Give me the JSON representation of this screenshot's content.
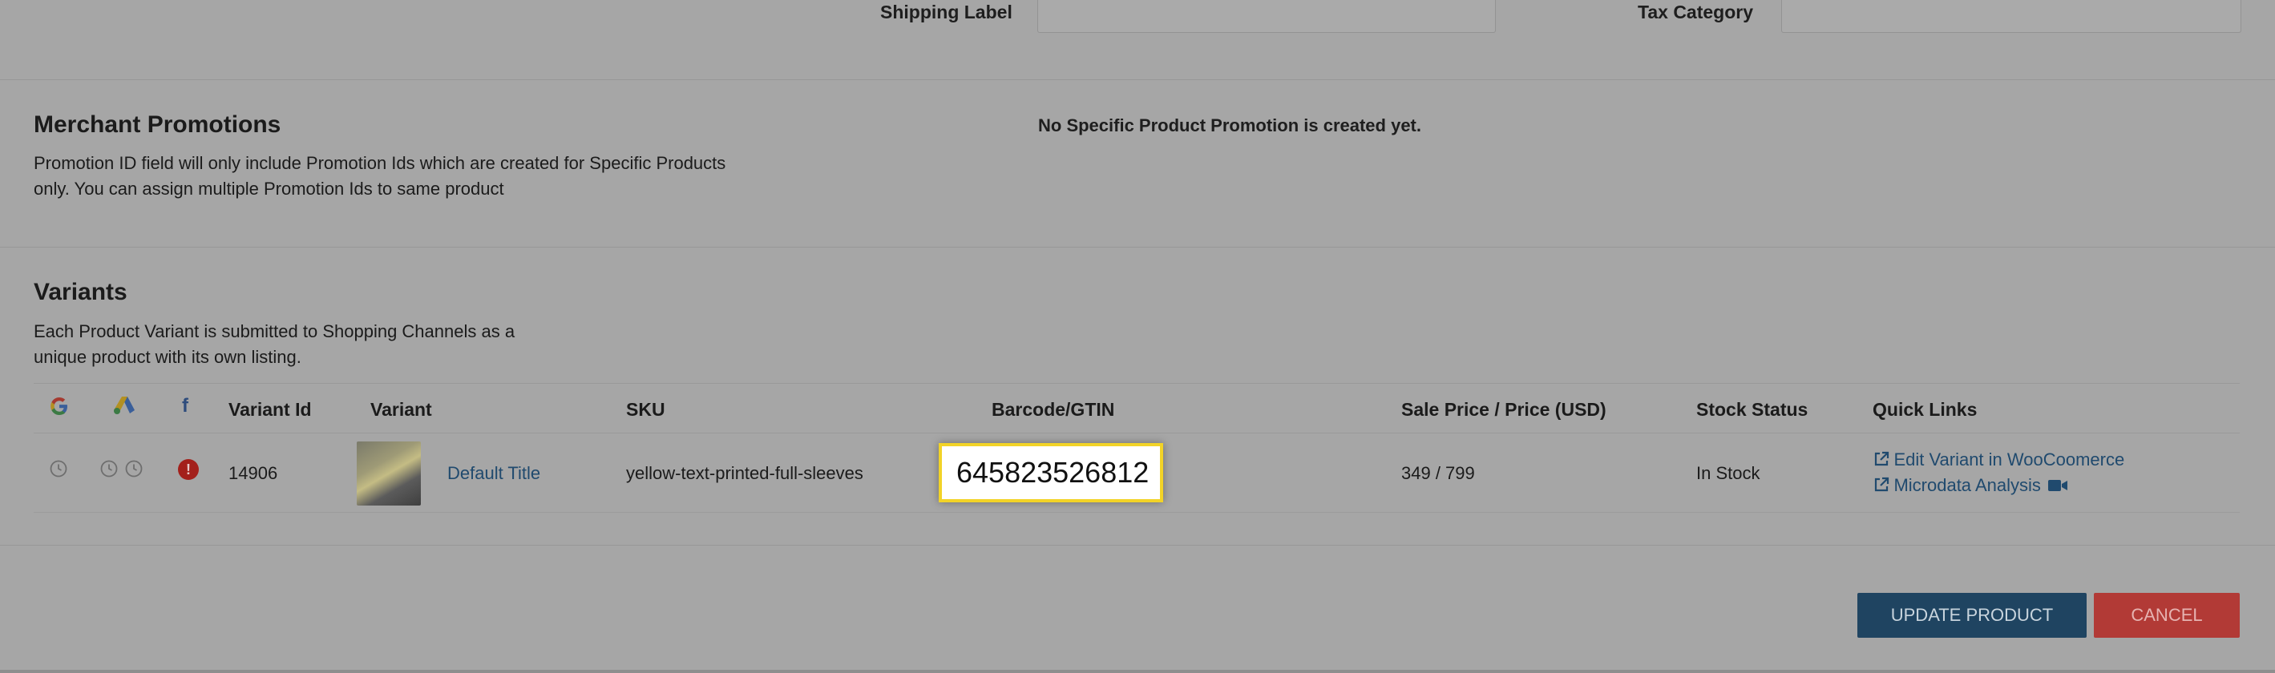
{
  "top_fields": {
    "shipping_label": "Shipping Label",
    "tax_category": "Tax Category"
  },
  "promotions": {
    "title": "Merchant Promotions",
    "description_line1": "Promotion ID field will only include Promotion Ids which are created for Specific Products",
    "description_line2": "only. You can assign multiple Promotion Ids to same product",
    "empty_message": "No Specific Product Promotion is created yet."
  },
  "variants": {
    "title": "Variants",
    "description_line1": "Each Product Variant is submitted to Shopping Channels as a",
    "description_line2": "unique product with its own listing.",
    "columns": {
      "variant_id": "Variant Id",
      "variant": "Variant",
      "sku": "SKU",
      "barcode": "Barcode/GTIN",
      "price": "Sale Price / Price (USD)",
      "stock": "Stock Status",
      "links": "Quick Links"
    },
    "row": {
      "variant_id": "14906",
      "variant_title": "Default Title",
      "sku": "yellow-text-printed-full-sleeves",
      "barcode": "645823526812",
      "price": "349 / 799",
      "stock": "In Stock",
      "link_edit": "Edit Variant in WooCoomerce",
      "link_microdata": "Microdata Analysis"
    },
    "channel_icons": [
      "google-icon",
      "google-ads-icon",
      "facebook-icon"
    ]
  },
  "actions": {
    "update": "UPDATE PRODUCT",
    "cancel": "CANCEL"
  },
  "colors": {
    "overlay_bg": "#a6a6a6",
    "primary_button": "#1f4461",
    "cancel_button": "#b23a36",
    "link": "#204a6e",
    "error": "#a3201b",
    "highlight_border": "#f2d327"
  }
}
